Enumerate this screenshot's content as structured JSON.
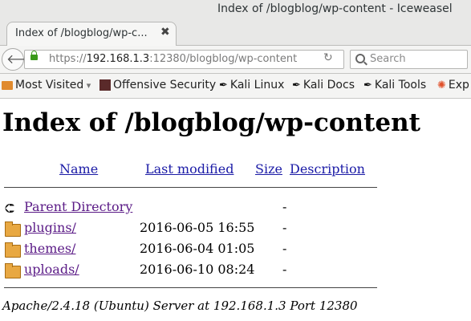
{
  "window": {
    "title": "Index of /blogblog/wp-content - Iceweasel"
  },
  "tab": {
    "label": "Index of /blogblog/wp-c...",
    "close": "✖",
    "new_tab": "+"
  },
  "navbar": {
    "url_scheme": "https://",
    "url_host": "192.168.1.3",
    "url_rest": ":12380/blogblog/wp-content",
    "search_placeholder": "Search"
  },
  "bookmarks": [
    {
      "label": "Most Visited",
      "icon": "folder-icon",
      "has_dropdown": true
    },
    {
      "label": "Offensive Security",
      "icon": "offsec-icon"
    },
    {
      "label": "Kali Linux",
      "icon": "kali-dragon-icon"
    },
    {
      "label": "Kali Docs",
      "icon": "kali-dragon-icon"
    },
    {
      "label": "Kali Tools",
      "icon": "kali-dragon-icon"
    },
    {
      "label": "Exp",
      "icon": "exploit-db-icon"
    }
  ],
  "page": {
    "heading": "Index of /blogblog/wp-content",
    "columns": {
      "name": "Name",
      "modified": "Last modified",
      "size": "Size",
      "description": "Description"
    },
    "rows": [
      {
        "name": "Parent Directory",
        "modified": "",
        "size": "-",
        "icon": "back-arrow-icon"
      },
      {
        "name": "plugins/",
        "modified": "2016-06-05 16:55",
        "size": "-",
        "icon": "folder-icon"
      },
      {
        "name": "themes/",
        "modified": "2016-06-04 01:05",
        "size": "-",
        "icon": "folder-icon"
      },
      {
        "name": "uploads/",
        "modified": "2016-06-10 08:24",
        "size": "-",
        "icon": "folder-icon"
      }
    ],
    "address": "Apache/2.4.18 (Ubuntu) Server at 192.168.1.3 Port 12380"
  }
}
